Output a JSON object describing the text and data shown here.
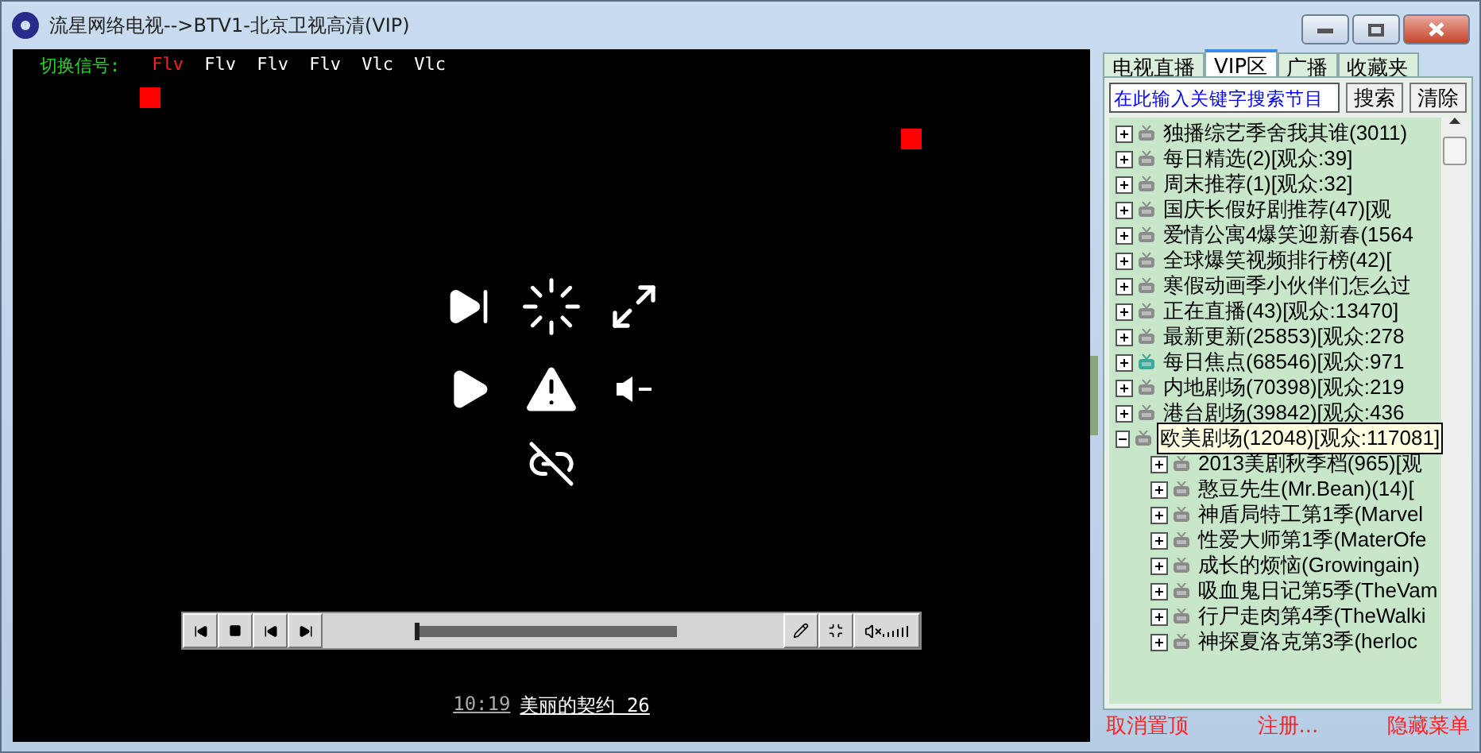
{
  "window": {
    "title": "流星网络电视-->BTV1-北京卫视高清(VIP)"
  },
  "signal": {
    "label": "切换信号:",
    "sources": [
      {
        "label": "Flv",
        "selected": true
      },
      {
        "label": "Flv",
        "selected": false
      },
      {
        "label": "Flv",
        "selected": false
      },
      {
        "label": "Flv",
        "selected": false
      },
      {
        "label": "Vlc",
        "selected": false
      },
      {
        "label": "Vlc",
        "selected": false
      }
    ]
  },
  "player": {
    "level": 0.2,
    "time": "10:19",
    "program": "美丽的契约 26"
  },
  "tabs": [
    {
      "label": "电视直播",
      "selected": false
    },
    {
      "label": "VIP区",
      "selected": true
    },
    {
      "label": "广播",
      "selected": false
    },
    {
      "label": "收藏夹",
      "selected": false
    }
  ],
  "search": {
    "placeholder": "在此输入关键字搜索节目",
    "buttons": [
      "搜索",
      "清除"
    ]
  },
  "tree": [
    {
      "label": "独播综艺季舍我其谁(3011)",
      "expanded": false,
      "selected": false,
      "color": "#8c8c8c"
    },
    {
      "label": "每日精选(2)[观众:39]",
      "expanded": false,
      "selected": false,
      "color": "#8c8c8c"
    },
    {
      "label": "周末推荐(1)[观众:32]",
      "expanded": false,
      "selected": false,
      "color": "#8c8c8c"
    },
    {
      "label": "国庆长假好剧推荐(47)[观",
      "expanded": false,
      "selected": false,
      "color": "#8c8c8c"
    },
    {
      "label": "爱情公寓4爆笑迎新春(1564",
      "expanded": false,
      "selected": false,
      "color": "#8c8c8c"
    },
    {
      "label": "全球爆笑视频排行榜(42)[",
      "expanded": false,
      "selected": false,
      "color": "#8c8c8c"
    },
    {
      "label": "寒假动画季小伙伴们怎么过",
      "expanded": false,
      "selected": false,
      "color": "#8c8c8c"
    },
    {
      "label": "正在直播(43)[观众:13470]",
      "expanded": false,
      "selected": false,
      "color": "#8c8c8c"
    },
    {
      "label": "最新更新(25853)[观众:278",
      "expanded": false,
      "selected": false,
      "color": "#8c8c8c"
    },
    {
      "label": "每日焦点(68546)[观众:971",
      "expanded": false,
      "selected": false,
      "color": "#3aa89a"
    },
    {
      "label": "内地剧场(70398)[观众:219",
      "expanded": false,
      "selected": false,
      "color": "#8c8c8c"
    },
    {
      "label": "港台剧场(39842)[观众:436",
      "expanded": false,
      "selected": false,
      "color": "#8c8c8c"
    },
    {
      "label": "欧美剧场(12048)[观众:117081]",
      "expanded": true,
      "selected": true,
      "color": "#8c8c8c",
      "children": [
        {
          "label": "2013美剧秋季档(965)[观",
          "expanded": false,
          "selected": false,
          "color": "#8c8c8c"
        },
        {
          "label": "憨豆先生(Mr.Bean)(14)[",
          "expanded": false,
          "selected": false,
          "color": "#8c8c8c"
        },
        {
          "label": "神盾局特工第1季(Marvel",
          "expanded": false,
          "selected": false,
          "color": "#8c8c8c"
        },
        {
          "label": "性爱大师第1季(MaterOfe",
          "expanded": false,
          "selected": false,
          "color": "#8c8c8c"
        },
        {
          "label": "成长的烦恼(Growingain)",
          "expanded": false,
          "selected": false,
          "color": "#8c8c8c"
        },
        {
          "label": "吸血鬼日记第5季(TheVam",
          "expanded": false,
          "selected": false,
          "color": "#8c8c8c"
        },
        {
          "label": "行尸走肉第4季(TheWalki",
          "expanded": false,
          "selected": false,
          "color": "#8c8c8c"
        },
        {
          "label": "神探夏洛克第3季(herloc",
          "expanded": false,
          "selected": false,
          "color": "#8c8c8c"
        }
      ]
    }
  ],
  "footer": [
    "取消置顶",
    "注册...",
    "隐藏菜单"
  ]
}
